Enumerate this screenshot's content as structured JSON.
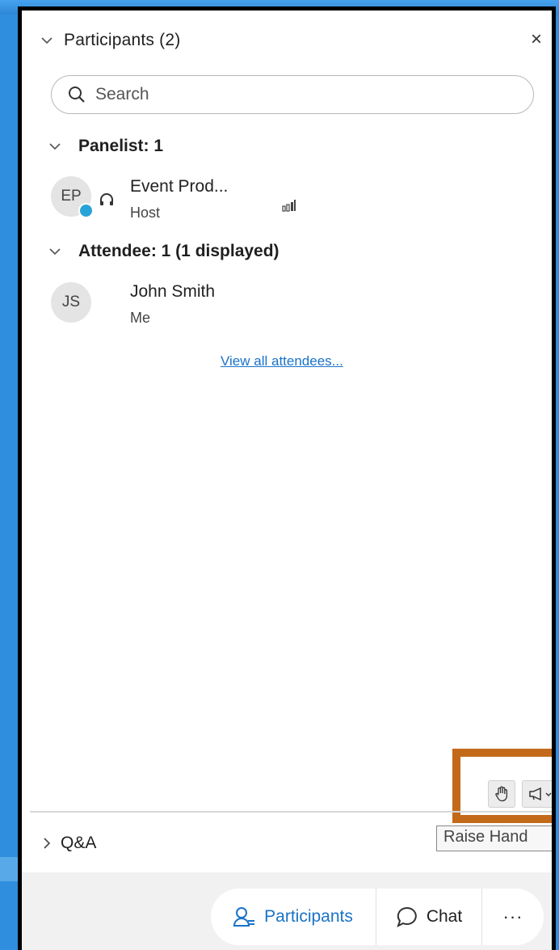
{
  "panel": {
    "title": "Participants (2)",
    "close_glyph": "×"
  },
  "search": {
    "placeholder": "Search"
  },
  "sections": {
    "panelist_header": "Panelist: 1",
    "attendee_header": "Attendee: 1 (1 displayed)"
  },
  "participants": [
    {
      "initials": "EP",
      "name": "Event Prod...",
      "role": "Host"
    },
    {
      "initials": "JS",
      "name": "John Smith",
      "role": "Me"
    }
  ],
  "view_all_link": "View all attendees...",
  "toolbar": {
    "raise_hand_icon": "hand-icon",
    "reactions_icon": "megaphone-icon",
    "tooltip": "Raise Hand"
  },
  "qa": {
    "label": "Q&A"
  },
  "footer": {
    "participants_label": "Participants",
    "chat_label": "Chat",
    "more_glyph": "···"
  },
  "colors": {
    "accent": "#1a73c7",
    "highlight_box": "#c36a1a",
    "status_dot": "#28a3d8"
  }
}
